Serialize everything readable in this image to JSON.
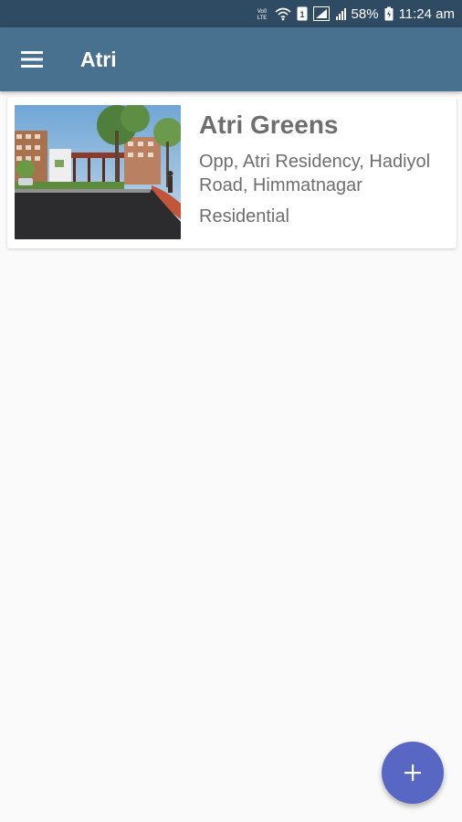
{
  "status_bar": {
    "network_label": "Vo0 LTE",
    "sim_badge": "1",
    "battery": "58%",
    "time": "11:24 am"
  },
  "app_bar": {
    "title": "Atri",
    "menu_icon": "hamburger-menu-icon"
  },
  "projects": [
    {
      "name": "Atri Greens",
      "address": "Opp, Atri Residency, Hadiyol Road, Himmatnagar",
      "type": "Residential"
    }
  ],
  "fab": {
    "icon": "plus-icon",
    "label": "+"
  },
  "colors": {
    "status_bar": "#2f4a63",
    "app_bar": "#48708f",
    "fab": "#5866c4",
    "background": "#fafafa",
    "text_secondary": "#6e6e6e"
  }
}
